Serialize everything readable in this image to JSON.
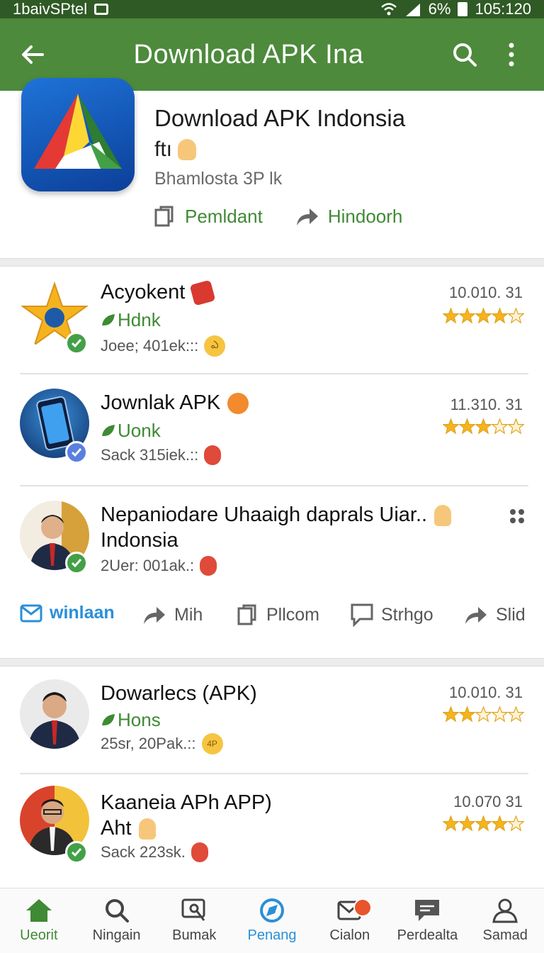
{
  "status": {
    "left_text": "1baivSPtel",
    "battery": "6%",
    "time": "105:120"
  },
  "appbar": {
    "title": "Download APK Ina"
  },
  "hero": {
    "title": "Download APK Indonsia",
    "subtitle": "ftı",
    "meta": "Bhamlosta 3P lk",
    "actions": [
      {
        "label": "Pemldant",
        "icon": "clipboard-icon"
      },
      {
        "label": "Hindoorh",
        "icon": "share-arrow-icon"
      }
    ]
  },
  "items": [
    {
      "name": "Acyokent",
      "tag": "Hdnk",
      "meta": "Joee; 401ek:::",
      "version": "10.010. 31",
      "rating": 4,
      "badge": "verified-green",
      "name_emoji": "red-tag",
      "meta_emoji": "sticker-yellow",
      "meta_emoji_text": "ఎ"
    },
    {
      "name": "Jownlak APK",
      "tag": "Uonk",
      "meta": "Sack 315iek.::",
      "version": "11.310. 31",
      "rating": 3,
      "badge": "verified-blue",
      "name_emoji": "orange-face",
      "meta_emoji": "red-bug"
    },
    {
      "name": "Nepaniodare Uhaaigh daprals Uiar..",
      "name2": "Indonsia",
      "meta": "2Uer: 001ak.:",
      "badge": "verified-green",
      "meta_emoji": "red-bug"
    },
    {
      "name": "Dowarlecs (APK)",
      "tag": "Hons",
      "meta": "25sr, 20Pak.::",
      "version": "10.010. 31",
      "rating": 2,
      "meta_emoji": "yellow-4p",
      "meta_emoji_text": "4P"
    },
    {
      "name": "Kaaneia APh APP)",
      "name2": "Aht",
      "meta": "Sack 223sk.",
      "version": "10.070 31",
      "rating": 4,
      "badge": "verified-green",
      "meta_emoji": "red-bug"
    }
  ],
  "actionrow": [
    {
      "label": "winlaan",
      "icon": "mail-icon"
    },
    {
      "label": "Mih",
      "icon": "share-arrow-icon"
    },
    {
      "label": "Pllcom",
      "icon": "clipboard-icon"
    },
    {
      "label": "Strhgo",
      "icon": "comment-icon"
    },
    {
      "label": "Slid",
      "icon": "share-arrow-icon"
    }
  ],
  "bottomnav": [
    {
      "label": "Ueorit",
      "icon": "home-icon"
    },
    {
      "label": "Ningain",
      "icon": "search-icon"
    },
    {
      "label": "Bumak",
      "icon": "screen-search-icon"
    },
    {
      "label": "Penang",
      "icon": "compass-icon"
    },
    {
      "label": "Cialon",
      "icon": "mail-check-icon"
    },
    {
      "label": "Perdealta",
      "icon": "chat-icon"
    },
    {
      "label": "Samad",
      "icon": "person-icon"
    }
  ],
  "colors": {
    "appbar": "#4d8a3c",
    "statusbar": "#2f5a25",
    "accent_green": "#3f8a34",
    "accent_blue": "#2a8fd8",
    "star": "#f5b41e"
  }
}
